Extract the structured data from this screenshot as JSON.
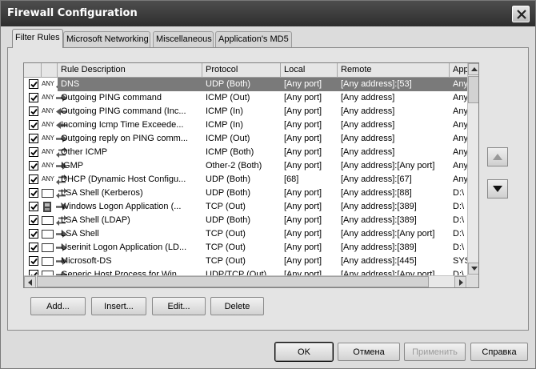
{
  "window": {
    "title": "Firewall Configuration"
  },
  "tabs": [
    {
      "label": "Filter Rules",
      "active": true
    },
    {
      "label": "Microsoft Networking"
    },
    {
      "label": "Miscellaneous"
    },
    {
      "label": "Application's MD5"
    }
  ],
  "table": {
    "columns": [
      "Rule Description",
      "Protocol",
      "Local",
      "Remote",
      "App"
    ],
    "rows": [
      {
        "icon": "any-both",
        "desc": "DNS",
        "protocol": "UDP (Both)",
        "local": "[Any port]",
        "remote": "[Any address]:[53]",
        "app": "Any",
        "checked": true,
        "selected": true
      },
      {
        "icon": "any-out",
        "desc": "Outgoing PING command",
        "protocol": "ICMP (Out)",
        "local": "[Any port]",
        "remote": "[Any address]",
        "app": "Any",
        "checked": true
      },
      {
        "icon": "any-in",
        "desc": "Outgoing PING command (Inc...",
        "protocol": "ICMP (In)",
        "local": "[Any port]",
        "remote": "[Any address]",
        "app": "Any",
        "checked": true
      },
      {
        "icon": "any-in",
        "desc": "Incoming Icmp Time Exceede...",
        "protocol": "ICMP (In)",
        "local": "[Any port]",
        "remote": "[Any address]",
        "app": "Any",
        "checked": true
      },
      {
        "icon": "any-out",
        "desc": "Outgoing reply on PING comm...",
        "protocol": "ICMP (Out)",
        "local": "[Any port]",
        "remote": "[Any address]",
        "app": "Any",
        "checked": true
      },
      {
        "icon": "any-both",
        "desc": "Other ICMP",
        "protocol": "ICMP (Both)",
        "local": "[Any port]",
        "remote": "[Any address]",
        "app": "Any",
        "checked": true
      },
      {
        "icon": "any-out",
        "desc": "IGMP",
        "protocol": "Other-2 (Both)",
        "local": "[Any port]",
        "remote": "[Any address]:[Any port]",
        "app": "Any",
        "checked": true
      },
      {
        "icon": "any-both",
        "desc": "DHCP (Dynamic Host Configu...",
        "protocol": "UDP (Both)",
        "local": "[68]",
        "remote": "[Any address]:[67]",
        "app": "Any",
        "checked": true
      },
      {
        "icon": "app-both",
        "desc": "LSA Shell (Kerberos)",
        "protocol": "UDP (Both)",
        "local": "[Any port]",
        "remote": "[Any address]:[88]",
        "app": "D:\\",
        "checked": true
      },
      {
        "icon": "logon-out",
        "desc": "Windows Logon Application (...",
        "protocol": "TCP (Out)",
        "local": "[Any port]",
        "remote": "[Any address]:[389]",
        "app": "D:\\",
        "checked": true
      },
      {
        "icon": "app-both",
        "desc": "LSA Shell (LDAP)",
        "protocol": "UDP (Both)",
        "local": "[Any port]",
        "remote": "[Any address]:[389]",
        "app": "D:\\",
        "checked": true
      },
      {
        "icon": "app-out",
        "desc": "LSA Shell",
        "protocol": "TCP (Out)",
        "local": "[Any port]",
        "remote": "[Any address]:[Any port]",
        "app": "D:\\",
        "checked": true
      },
      {
        "icon": "app-out",
        "desc": "Userinit Logon Application (LD...",
        "protocol": "TCP (Out)",
        "local": "[Any port]",
        "remote": "[Any address]:[389]",
        "app": "D:\\",
        "checked": true
      },
      {
        "icon": "app-out",
        "desc": "Microsoft-DS",
        "protocol": "TCP (Out)",
        "local": "[Any port]",
        "remote": "[Any address]:[445]",
        "app": "SYS",
        "checked": true
      },
      {
        "icon": "app-out",
        "desc": "Generic Host Process for Win...",
        "protocol": "UDP/TCP (Out)",
        "local": "[Any port]",
        "remote": "[Any address]:[Any port]",
        "app": "D:\\",
        "checked": true
      }
    ]
  },
  "any_label": "ANY",
  "list_buttons": {
    "add": "Add...",
    "insert": "Insert...",
    "edit": "Edit...",
    "delete": "Delete"
  },
  "dialog_buttons": {
    "ok": "OK",
    "cancel": "Отмена",
    "apply": "Применить",
    "help": "Справка"
  }
}
